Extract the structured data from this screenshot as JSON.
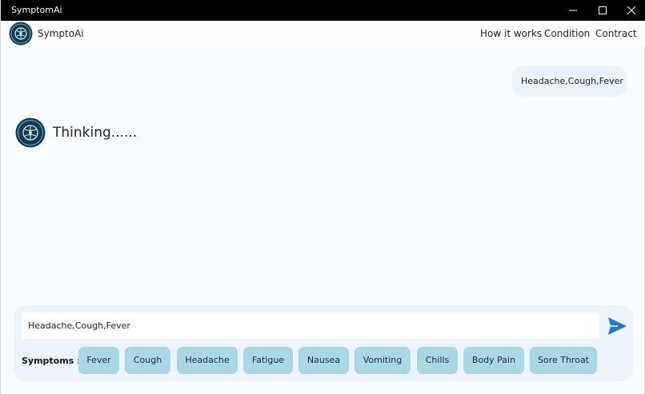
{
  "window": {
    "title": "SymptomAi"
  },
  "header": {
    "brand": "SymptoAi",
    "nav": [
      "How it works",
      "Condition",
      "Contract"
    ]
  },
  "chat": {
    "user_message": "Headache,Cough,Fever",
    "bot_status": "Thinking......"
  },
  "composer": {
    "input_value": "Headache,Cough,Fever",
    "symptoms_label": "Symptoms :",
    "chips": [
      "Fever",
      "Cough",
      "Headache",
      "Fatigue",
      "Nausea",
      "Vomiting",
      "Chills",
      "Body Pain",
      "Sore Throat"
    ]
  },
  "icons": {
    "minimize": "minimize-icon",
    "maximize": "maximize-icon",
    "close": "close-icon",
    "send": "send-icon",
    "logo": "brain-logo-icon"
  },
  "colors": {
    "accent": "#1e7bd2",
    "chip_bg": "#a7d8e4",
    "bubble_bg": "#edf3fb",
    "composer_bg": "#eef4fc"
  }
}
